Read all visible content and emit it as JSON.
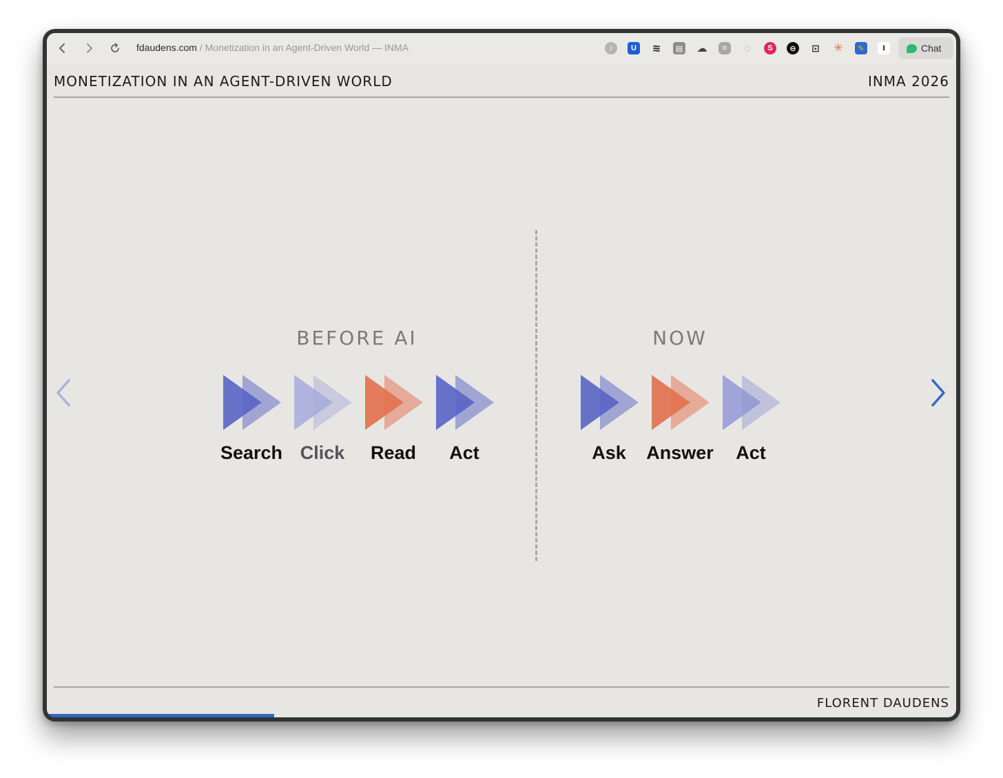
{
  "browser": {
    "url_host": "fdaudens.com",
    "url_separator": " / ",
    "url_path": "Monetization in an Agent-Driven World — INMA",
    "chat_label": "Chat",
    "extensions": [
      "music-ext-icon",
      "bitwarden-icon",
      "buffer-icon",
      "copy-ext-icon",
      "cloud-ext-icon",
      "stack-ext-icon",
      "brain-ext-icon",
      "s-ext-icon",
      "record-ext-icon",
      "robot-ext-icon",
      "sparkle-ext-icon",
      "pencil-ext-icon",
      "instapaper-icon"
    ]
  },
  "slide": {
    "title": "MONETIZATION IN AN AGENT-DRIVEN WORLD",
    "event": "INMA 2026",
    "author": "FLORENT DAUDENS",
    "progress_fraction": 0.25,
    "before": {
      "heading": "BEFORE AI",
      "steps": [
        {
          "label": "Search",
          "color": "#5a64c4",
          "opacity": 0.9
        },
        {
          "label": "Click",
          "color": "#a3a7d9",
          "opacity": 0.8
        },
        {
          "label": "Read",
          "color": "#e2704e",
          "opacity": 0.9
        },
        {
          "label": "Act",
          "color": "#5a64c4",
          "opacity": 0.9
        }
      ]
    },
    "now": {
      "heading": "NOW",
      "steps": [
        {
          "label": "Ask",
          "color": "#5a64c4",
          "opacity": 0.9
        },
        {
          "label": "Answer",
          "color": "#e2704e",
          "opacity": 0.9
        },
        {
          "label": "Act",
          "color": "#8d93d4",
          "opacity": 0.8
        }
      ]
    }
  },
  "colors": {
    "accent": "#3367c2",
    "background": "#e8e6e3"
  }
}
